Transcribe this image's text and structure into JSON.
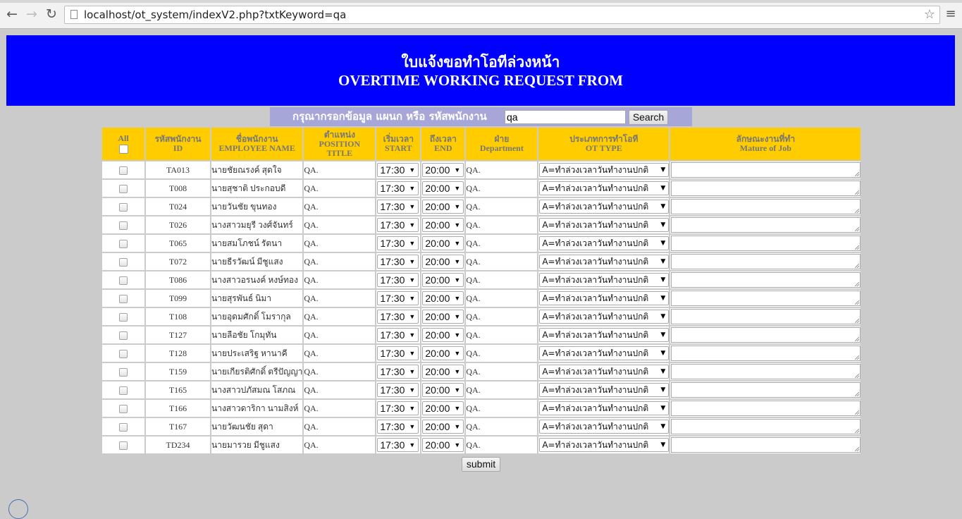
{
  "browser": {
    "url": "localhost/ot_system/indexV2.php?txtKeyword=qa",
    "back_icon": "arrow-left-icon",
    "forward_icon": "arrow-right-icon",
    "reload_icon": "reload-icon",
    "bookmark_icon": "star-icon",
    "menu_icon": "hamburger-menu-icon"
  },
  "header": {
    "title_th": "ใบแจ้งขอทำโอทีล่วงหน้า",
    "title_en": "OVERTIME WORKING REQUEST FROM",
    "background": "#0000ff"
  },
  "search": {
    "label": "กรุณากรอกข้อมูล แผนก หรือ รหัสพนักงาน",
    "keyword": "qa",
    "button": "Search"
  },
  "table": {
    "headers": {
      "all": "All",
      "id_th": "รหัสพนักงาน",
      "id_en": "ID",
      "name_th": "ชื่อพนักงาน",
      "name_en": "EMPLOYEE NAME",
      "pos_th": "ตำแหน่ง",
      "pos_en1": "POSITION",
      "pos_en2": "TITLE",
      "start_th": "เริ่มเวลา",
      "start_en": "START",
      "end_th": "ถึงเวลา",
      "end_en": "END",
      "dep_th": "ฝ่าย",
      "dep_en": "Department",
      "type_th": "ประเภทการทำโอที",
      "type_en": "OT TYPE",
      "job_th": "ลักษณะงานที่ทำ",
      "job_en": "Mature of Job"
    },
    "header_color": "#ffcc00",
    "rows": [
      {
        "id": "TA013",
        "name": "นายชัยณรงค์ สุดใจ",
        "position": "QA.",
        "start": "17:30",
        "end": "20:00",
        "department": "QA.",
        "ot_type": "A=ทำล่วงเวลาวันทำงานปกติ"
      },
      {
        "id": "T008",
        "name": "นายสุชาติ ประกอบดี",
        "position": "QA.",
        "start": "17:30",
        "end": "20:00",
        "department": "QA.",
        "ot_type": "A=ทำล่วงเวลาวันทำงานปกติ"
      },
      {
        "id": "T024",
        "name": "นายวันชัย ขุนทอง",
        "position": "QA.",
        "start": "17:30",
        "end": "20:00",
        "department": "QA.",
        "ot_type": "A=ทำล่วงเวลาวันทำงานปกติ"
      },
      {
        "id": "T026",
        "name": "นางสาวมยุรี วงศ์จันทร์",
        "position": "QA.",
        "start": "17:30",
        "end": "20:00",
        "department": "QA.",
        "ot_type": "A=ทำล่วงเวลาวันทำงานปกติ"
      },
      {
        "id": "T065",
        "name": "นายสมโภชน์ รัตนา",
        "position": "QA.",
        "start": "17:30",
        "end": "20:00",
        "department": "QA.",
        "ot_type": "A=ทำล่วงเวลาวันทำงานปกติ"
      },
      {
        "id": "T072",
        "name": "นายธีรวัฒน์ มีชูแสง",
        "position": "QA.",
        "start": "17:30",
        "end": "20:00",
        "department": "QA.",
        "ot_type": "A=ทำล่วงเวลาวันทำงานปกติ"
      },
      {
        "id": "T086",
        "name": "นางสาวอรนงค์ หงษ์ทอง",
        "position": "QA.",
        "start": "17:30",
        "end": "20:00",
        "department": "QA.",
        "ot_type": "A=ทำล่วงเวลาวันทำงานปกติ"
      },
      {
        "id": "T099",
        "name": "นายสุรพันธ์ นิมา",
        "position": "QA.",
        "start": "17:30",
        "end": "20:00",
        "department": "QA.",
        "ot_type": "A=ทำล่วงเวลาวันทำงานปกติ"
      },
      {
        "id": "T108",
        "name": "นายอุดมศักดิ์ โมรากุล",
        "position": "QA.",
        "start": "17:30",
        "end": "20:00",
        "department": "QA.",
        "ot_type": "A=ทำล่วงเวลาวันทำงานปกติ"
      },
      {
        "id": "T127",
        "name": "นายลือชัย โกมุทัน",
        "position": "QA.",
        "start": "17:30",
        "end": "20:00",
        "department": "QA.",
        "ot_type": "A=ทำล่วงเวลาวันทำงานปกติ"
      },
      {
        "id": "T128",
        "name": "นายประเสริฐ หานาคี",
        "position": "QA.",
        "start": "17:30",
        "end": "20:00",
        "department": "QA.",
        "ot_type": "A=ทำล่วงเวลาวันทำงานปกติ"
      },
      {
        "id": "T159",
        "name": "นายเกียรติศักดิ์ ตรีปัญญา",
        "position": "QA.",
        "start": "17:30",
        "end": "20:00",
        "department": "QA.",
        "ot_type": "A=ทำล่วงเวลาวันทำงานปกติ"
      },
      {
        "id": "T165",
        "name": "นางสาวปภัสมณ โสภณ",
        "position": "QA.",
        "start": "17:30",
        "end": "20:00",
        "department": "QA.",
        "ot_type": "A=ทำล่วงเวลาวันทำงานปกติ"
      },
      {
        "id": "T166",
        "name": "นางสาวดาริกา นามสิงห์",
        "position": "QA.",
        "start": "17:30",
        "end": "20:00",
        "department": "QA.",
        "ot_type": "A=ทำล่วงเวลาวันทำงานปกติ"
      },
      {
        "id": "T167",
        "name": "นายวัฒนชัย สุดา",
        "position": "QA.",
        "start": "17:30",
        "end": "20:00",
        "department": "QA.",
        "ot_type": "A=ทำล่วงเวลาวันทำงานปกติ"
      },
      {
        "id": "TD234",
        "name": "นายมารวย มีชูแสง",
        "position": "QA.",
        "start": "17:30",
        "end": "20:00",
        "department": "QA.",
        "ot_type": "A=ทำล่วงเวลาวันทำงานปกติ"
      }
    ]
  },
  "form": {
    "submit": "submit"
  }
}
